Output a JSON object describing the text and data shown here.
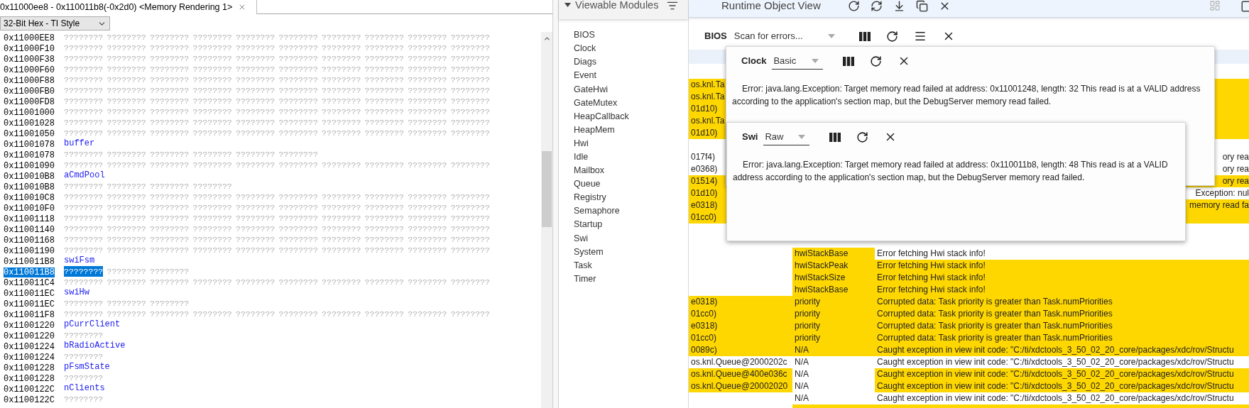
{
  "memory_tab": {
    "title": "0x11000ee8 - 0x110011b8(-0x2d0) <Memory Rendering 1>"
  },
  "format_select": {
    "value": "32-Bit Hex - TI Style"
  },
  "memory_rows": [
    {
      "kind": "data",
      "address": "0x11000EE8",
      "selected": false,
      "values": [
        "????????",
        "????????",
        "????????",
        "????????",
        "????????",
        "????????",
        "????????",
        "????????",
        "????????",
        "????????"
      ]
    },
    {
      "kind": "data",
      "address": "0x11000F10",
      "selected": false,
      "values": [
        "????????",
        "????????",
        "????????",
        "????????",
        "????????",
        "????????",
        "????????",
        "????????",
        "????????",
        "????????"
      ]
    },
    {
      "kind": "data",
      "address": "0x11000F38",
      "selected": false,
      "values": [
        "????????",
        "????????",
        "????????",
        "????????",
        "????????",
        "????????",
        "????????",
        "????????",
        "????????",
        "????????"
      ]
    },
    {
      "kind": "data",
      "address": "0x11000F60",
      "selected": false,
      "values": [
        "????????",
        "????????",
        "????????",
        "????????",
        "????????",
        "????????",
        "????????",
        "????????",
        "????????",
        "????????"
      ]
    },
    {
      "kind": "data",
      "address": "0x11000F88",
      "selected": false,
      "values": [
        "????????",
        "????????",
        "????????",
        "????????",
        "????????",
        "????????",
        "????????",
        "????????",
        "????????",
        "????????"
      ]
    },
    {
      "kind": "data",
      "address": "0x11000FB0",
      "selected": false,
      "values": [
        "????????",
        "????????",
        "????????",
        "????????",
        "????????",
        "????????",
        "????????",
        "????????",
        "????????",
        "????????"
      ]
    },
    {
      "kind": "data",
      "address": "0x11000FD8",
      "selected": false,
      "values": [
        "????????",
        "????????",
        "????????",
        "????????",
        "????????",
        "????????",
        "????????",
        "????????",
        "????????",
        "????????"
      ]
    },
    {
      "kind": "data",
      "address": "0x11001000",
      "selected": false,
      "values": [
        "????????",
        "????????",
        "????????",
        "????????",
        "????????",
        "????????",
        "????????",
        "????????",
        "????????",
        "????????"
      ]
    },
    {
      "kind": "data",
      "address": "0x11001028",
      "selected": false,
      "values": [
        "????????",
        "????????",
        "????????",
        "????????",
        "????????",
        "????????",
        "????????",
        "????????",
        "????????",
        "????????"
      ]
    },
    {
      "kind": "data",
      "address": "0x11001050",
      "selected": false,
      "values": [
        "????????",
        "????????",
        "????????",
        "????????",
        "????????",
        "????????",
        "????????",
        "????????",
        "????????",
        "????????"
      ]
    },
    {
      "kind": "symbol",
      "address": "0x11001078",
      "selected": false,
      "label": "buffer"
    },
    {
      "kind": "data",
      "address": "0x11001078",
      "selected": false,
      "values": [
        "????????",
        "????????",
        "????????",
        "????????",
        "????????",
        "????????"
      ]
    },
    {
      "kind": "data",
      "address": "0x11001090",
      "selected": false,
      "values": [
        "????????",
        "????????",
        "????????",
        "????????",
        "????????",
        "????????",
        "????????",
        "????????",
        "????????",
        "????????"
      ]
    },
    {
      "kind": "symbol",
      "address": "0x110010B8",
      "selected": false,
      "label": "aCmdPool"
    },
    {
      "kind": "data",
      "address": "0x110010B8",
      "selected": false,
      "values": [
        "????????",
        "????????",
        "????????",
        "????????"
      ]
    },
    {
      "kind": "data",
      "address": "0x110010C8",
      "selected": false,
      "values": [
        "????????",
        "????????",
        "????????",
        "????????",
        "????????",
        "????????",
        "????????",
        "????????",
        "????????",
        "????????"
      ]
    },
    {
      "kind": "data",
      "address": "0x110010F0",
      "selected": false,
      "values": [
        "????????",
        "????????",
        "????????",
        "????????",
        "????????",
        "????????",
        "????????",
        "????????",
        "????????",
        "????????"
      ]
    },
    {
      "kind": "data",
      "address": "0x11001118",
      "selected": false,
      "values": [
        "????????",
        "????????",
        "????????",
        "????????",
        "????????",
        "????????",
        "????????",
        "????????",
        "????????",
        "????????"
      ]
    },
    {
      "kind": "data",
      "address": "0x11001140",
      "selected": false,
      "values": [
        "????????",
        "????????",
        "????????",
        "????????",
        "????????",
        "????????",
        "????????",
        "????????",
        "????????",
        "????????"
      ]
    },
    {
      "kind": "data",
      "address": "0x11001168",
      "selected": false,
      "values": [
        "????????",
        "????????",
        "????????",
        "????????",
        "????????",
        "????????",
        "????????",
        "????????",
        "????????",
        "????????"
      ]
    },
    {
      "kind": "data",
      "address": "0x11001190",
      "selected": false,
      "values": [
        "????????",
        "????????",
        "????????",
        "????????",
        "????????",
        "????????",
        "????????",
        "????????",
        "????????",
        "????????"
      ]
    },
    {
      "kind": "symbol",
      "address": "0x110011B8",
      "selected": false,
      "label": "swiFsm"
    },
    {
      "kind": "data",
      "address": "0x110011B8",
      "selected": true,
      "values": [
        "????????",
        "????????",
        "????????"
      ]
    },
    {
      "kind": "data",
      "address": "0x110011C4",
      "selected": false,
      "values": [
        "????????",
        "????????",
        "????????",
        "????????",
        "????????",
        "????????",
        "????????",
        "????????",
        "????????",
        "????????"
      ]
    },
    {
      "kind": "symbol",
      "address": "0x110011EC",
      "selected": false,
      "label": "swiHw"
    },
    {
      "kind": "data",
      "address": "0x110011EC",
      "selected": false,
      "values": [
        "????????",
        "????????",
        "????????"
      ]
    },
    {
      "kind": "data",
      "address": "0x110011F8",
      "selected": false,
      "values": [
        "????????",
        "????????",
        "????????",
        "????????",
        "????????",
        "????????",
        "????????",
        "????????",
        "????????",
        "????????"
      ]
    },
    {
      "kind": "symbol",
      "address": "0x11001220",
      "selected": false,
      "label": "pCurrClient"
    },
    {
      "kind": "data",
      "address": "0x11001220",
      "selected": false,
      "values": [
        "????????"
      ]
    },
    {
      "kind": "symbol",
      "address": "0x11001224",
      "selected": false,
      "label": "bRadioActive"
    },
    {
      "kind": "data",
      "address": "0x11001224",
      "selected": false,
      "values": [
        "????????"
      ]
    },
    {
      "kind": "symbol",
      "address": "0x11001228",
      "selected": false,
      "label": "pFsmState"
    },
    {
      "kind": "data",
      "address": "0x11001228",
      "selected": false,
      "values": [
        "????????"
      ]
    },
    {
      "kind": "symbol",
      "address": "0x1100122C",
      "selected": false,
      "label": "nClients"
    },
    {
      "kind": "data",
      "address": "0x1100122C",
      "selected": false,
      "values": [
        "????????"
      ]
    }
  ],
  "modules_panel": {
    "title": "Viewable Modules",
    "items": [
      {
        "label": "BIOS"
      },
      {
        "label": "Clock"
      },
      {
        "label": "Diags"
      },
      {
        "label": "Event"
      },
      {
        "label": "GateHwi"
      },
      {
        "label": "GateMutex"
      },
      {
        "label": "HeapCallback"
      },
      {
        "label": "HeapMem"
      },
      {
        "label": "Hwi"
      },
      {
        "label": "Idle"
      },
      {
        "label": "Mailbox"
      },
      {
        "label": "Queue"
      },
      {
        "label": "Registry"
      },
      {
        "label": "Semaphore"
      },
      {
        "label": "Startup"
      },
      {
        "label": "Swi"
      },
      {
        "label": "System"
      },
      {
        "label": "Task"
      },
      {
        "label": "Timer"
      }
    ]
  },
  "runtime_view": {
    "title": "Runtime Object View"
  },
  "bios_bar": {
    "module": "BIOS",
    "view": "Scan for errors..."
  },
  "table_rows": [
    {
      "column_1": {
        "text": "os.knl.Ta",
        "error": true
      },
      "column_3": {
        "kind": "tail",
        "error": true
      }
    },
    {
      "column_1": {
        "text": "os.knl.Ta",
        "error": true
      },
      "column_3": {
        "kind": "tail",
        "error": true
      }
    },
    {
      "column_1": {
        "text": "01d10)",
        "error": true
      },
      "column_3": {
        "kind": "tail",
        "error": true
      }
    },
    {
      "column_1": {
        "text": "os.knl.Ta",
        "error": true
      },
      "column_3": {
        "kind": "tail",
        "error": true
      }
    },
    {
      "column_1": {
        "text": "01d10)",
        "error": true
      },
      "column_3": {
        "kind": "tail",
        "error": true
      }
    },
    {},
    {
      "column_1": {
        "text": "017f4)",
        "error": false
      },
      "column_3": {
        "kind": "tail",
        "text": "ory rea",
        "error": false
      }
    },
    {
      "column_1": {
        "text": "e0368)",
        "error": false
      },
      "column_3": {
        "kind": "tail",
        "text": "ory rea",
        "error": false
      }
    },
    {
      "column_1": {
        "text": "01514)",
        "error": true
      },
      "column_3": {
        "kind": "tail",
        "text": "ory rea",
        "error": true
      }
    },
    {
      "column_1": {
        "text": "01d10)",
        "error": true
      },
      "column_3": {
        "kind": "tail",
        "text": "Exception: nul",
        "error": false
      }
    },
    {
      "column_1": {
        "text": "e0318)",
        "error": true
      },
      "column_3": {
        "kind": "tail",
        "text": "memory read fa",
        "error": true
      }
    },
    {
      "column_1": {
        "text": "01cc0)",
        "error": true
      },
      "column_3": {
        "kind": "tail",
        "error": true
      }
    },
    {},
    {},
    {
      "column_2": {
        "text": "hwiStackBase",
        "error": true
      },
      "column_3": {
        "kind": "full",
        "text": "Error fetching Hwi stack info!",
        "error": false
      }
    },
    {
      "column_2": {
        "text": "hwiStackPeak",
        "error": true
      },
      "column_3": {
        "kind": "full",
        "text": "Error fetching Hwi stack info!",
        "error": true
      }
    },
    {
      "column_2": {
        "text": "hwiStackSize",
        "error": true
      },
      "column_3": {
        "kind": "full",
        "text": "Error fetching Hwi stack info!",
        "error": true
      }
    },
    {
      "column_2": {
        "text": "hwiStackBase",
        "error": true
      },
      "column_3": {
        "kind": "full",
        "text": "Error fetching Hwi stack info!",
        "error": true
      }
    },
    {
      "column_1": {
        "text": "e0318)",
        "error": true
      },
      "column_2": {
        "text": "priority",
        "error": true
      },
      "column_3": {
        "kind": "full",
        "text": "Corrupted data: Task priority is greater than Task.numPriorities",
        "error": true
      }
    },
    {
      "column_1": {
        "text": "01cc0)",
        "error": true
      },
      "column_2": {
        "text": "priority",
        "error": true
      },
      "column_3": {
        "kind": "full",
        "text": "Corrupted data: Task priority is greater than Task.numPriorities",
        "error": true
      }
    },
    {
      "column_1": {
        "text": "e0318)",
        "error": true
      },
      "column_2": {
        "text": "priority",
        "error": true
      },
      "column_3": {
        "kind": "full",
        "text": "Corrupted data: Task priority is greater than Task.numPriorities",
        "error": true
      }
    },
    {
      "column_1": {
        "text": "01cc0)",
        "error": true
      },
      "column_2": {
        "text": "priority",
        "error": true
      },
      "column_3": {
        "kind": "full",
        "text": "Corrupted data: Task priority is greater than Task.numPriorities",
        "error": true
      }
    },
    {
      "column_1": {
        "text": "0089c)",
        "error": true
      },
      "column_2": {
        "text": "N/A",
        "error": true
      },
      "column_3": {
        "kind": "full",
        "text": "Caught exception in view init code: \"C:/ti/xdctools_3_50_02_20_core/packages/xdc/rov/Structu",
        "error": true
      }
    },
    {
      "column_1": {
        "text": "os.knl.Queue@2000202c",
        "error": false
      },
      "column_2": {
        "text": "N/A",
        "error": false
      },
      "column_3": {
        "kind": "full",
        "text": "Caught exception in view init code: \"C:/ti/xdctools_3_50_02_20_core/packages/xdc/rov/Structu",
        "error": false
      }
    },
    {
      "column_1": {
        "text": "os.knl.Queue@400e036c",
        "error": true
      },
      "column_2": {
        "text": "N/A",
        "error": false
      },
      "column_3": {
        "kind": "full",
        "text": "Caught exception in view init code: \"C:/ti/xdctools_3_50_02_20_core/packages/xdc/rov/Structu",
        "error": true
      }
    },
    {
      "column_1": {
        "text": "os.knl.Queue@20002020",
        "error": true
      },
      "column_2": {
        "text": "N/A",
        "error": false
      },
      "column_3": {
        "kind": "full",
        "text": "Caught exception in view init code: \"C:/ti/xdctools_3_50_02_20_core/packages/xdc/rov/Structu",
        "error": true
      }
    },
    {
      "column_2": {
        "text": "N/A",
        "error": false
      },
      "column_3": {
        "kind": "full",
        "text": "Caught exception in view init code: \"C:/ti/xdctools_3_50_02_20_core/packages/xdc/rov/Structu",
        "error": false
      }
    },
    {
      "column_2": {
        "error": true
      },
      "column_3": {
        "kind": "full",
        "error": true
      }
    }
  ],
  "popups": [
    {
      "module": "Clock",
      "view": "Basic",
      "message": "Error: java.lang.Exception: Target memory read failed at address: 0x11001248, length: 32 This read is at a VALID address according to the application's section map, but the DebugServer memory read failed."
    },
    {
      "module": "Swi",
      "view": "Raw",
      "message": "Error: java.lang.Exception: Target memory read failed at address: 0x110011b8, length: 48 This read is at a VALID address according to the application's section map, but the DebugServer memory read failed."
    }
  ]
}
